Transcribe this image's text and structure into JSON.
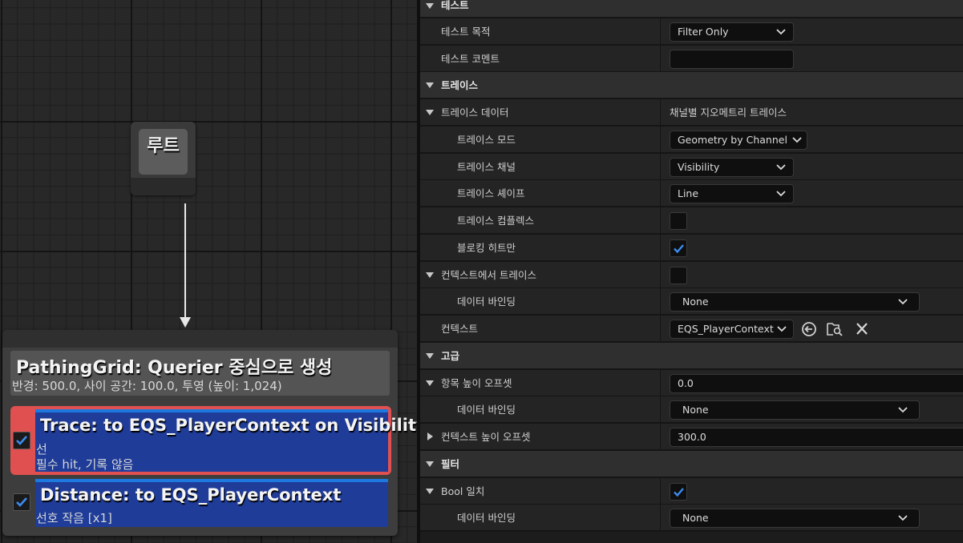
{
  "graph": {
    "root_label": "루트",
    "generator": {
      "title": "PathingGrid: Querier 중심으로 생성",
      "subtitle": "반경: 500.0, 사이 공간: 100.0, 투영 (높이: 1,024)"
    },
    "tests": [
      {
        "title": "Trace: to EQS_PlayerContext on Visibility",
        "line1": "선",
        "line2": "필수 hit, 기록 않음",
        "checked": true,
        "selected": true
      },
      {
        "title": "Distance: to EQS_PlayerContext",
        "line1": "선호 작음 [x1]",
        "checked": true,
        "selected": false
      }
    ]
  },
  "details": {
    "test_category": "테스트",
    "test_purpose_label": "테스트 목적",
    "test_purpose_value": "Filter Only",
    "test_comment_label": "테스트 코멘트",
    "test_comment_value": "",
    "trace_category": "트레이스",
    "trace_data_label": "트레이스 데이터",
    "trace_data_value": "채널별 지오메트리 트레이스",
    "trace_mode_label": "트레이스 모드",
    "trace_mode_value": "Geometry by Channel",
    "trace_channel_label": "트레이스 채널",
    "trace_channel_value": "Visibility",
    "trace_shape_label": "트레이스 셰이프",
    "trace_shape_value": "Line",
    "trace_complex_label": "트레이스 컴플렉스",
    "trace_complex_checked": false,
    "blocking_hit_label": "블로킹 히트만",
    "blocking_hit_checked": true,
    "trace_from_context_label": "컨텍스트에서 트레이스",
    "trace_from_context_checked": false,
    "data_binding_label": "데이터 바인딩",
    "data_binding_value": "None",
    "context_label": "컨텍스트",
    "context_value": "EQS_PlayerContext",
    "advanced_category": "고급",
    "item_height_offset_label": "항목 높이 오프셋",
    "item_height_offset_value": "0.0",
    "item_data_binding_label": "데이터 바인딩",
    "item_data_binding_value": "None",
    "context_height_offset_label": "컨텍스트 높이 오프셋",
    "context_height_offset_value": "300.0",
    "filter_category": "필터",
    "bool_match_label": "Bool 일치",
    "bool_match_checked": true,
    "bool_data_binding_label": "데이터 바인딩",
    "bool_data_binding_value": "None"
  },
  "colors": {
    "accent": "#1d78e0",
    "selected_test": "#e05050",
    "test_body": "#1f3c99"
  }
}
